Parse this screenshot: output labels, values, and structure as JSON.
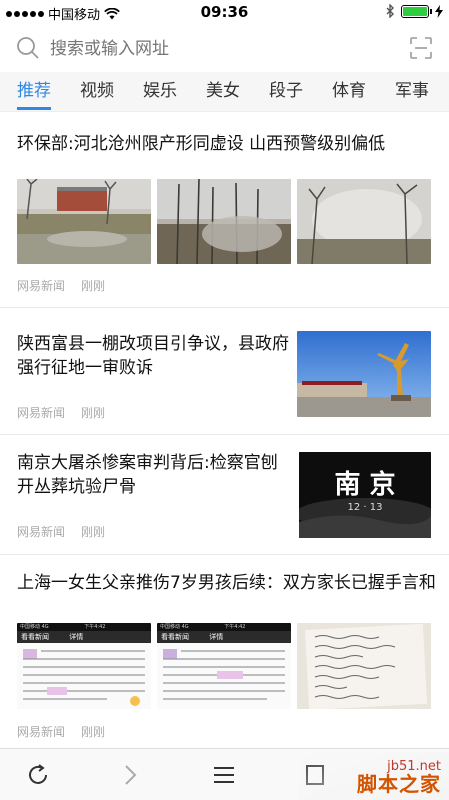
{
  "status_bar": {
    "carrier": "中国移动",
    "time": "09:36"
  },
  "search": {
    "placeholder": "搜索或输入网址"
  },
  "tabs": [
    {
      "label": "推荐",
      "active": true
    },
    {
      "label": "视频",
      "active": false
    },
    {
      "label": "娱乐",
      "active": false
    },
    {
      "label": "美女",
      "active": false
    },
    {
      "label": "段子",
      "active": false
    },
    {
      "label": "体育",
      "active": false
    },
    {
      "label": "军事",
      "active": false
    }
  ],
  "feed": [
    {
      "title": "环保部:河北沧州限产形同虚设 山西预警级别偏低",
      "source": "网易新闻",
      "time": "刚刚"
    },
    {
      "title": "陕西富县一棚改项目引争议，县政府强行征地一审败诉",
      "source": "网易新闻",
      "time": "刚刚"
    },
    {
      "title": "南京大屠杀惨案审判背后:检察官刨开丛葬坑验尸骨",
      "source": "网易新闻",
      "time": "刚刚",
      "image_text_main": "南 京",
      "image_text_date": "12 · 13"
    },
    {
      "title": "上海一女生父亲推伤7岁男孩后续：双方家长已握手言和",
      "source": "网易新闻",
      "time": "刚刚",
      "screenshot_status": "中国移动 4G",
      "screenshot_time": "下午4:42",
      "screenshot_back": "看看新闻",
      "screenshot_title": "详情"
    }
  ],
  "watermark": {
    "site": "jb51.net",
    "name": "脚本之家"
  }
}
